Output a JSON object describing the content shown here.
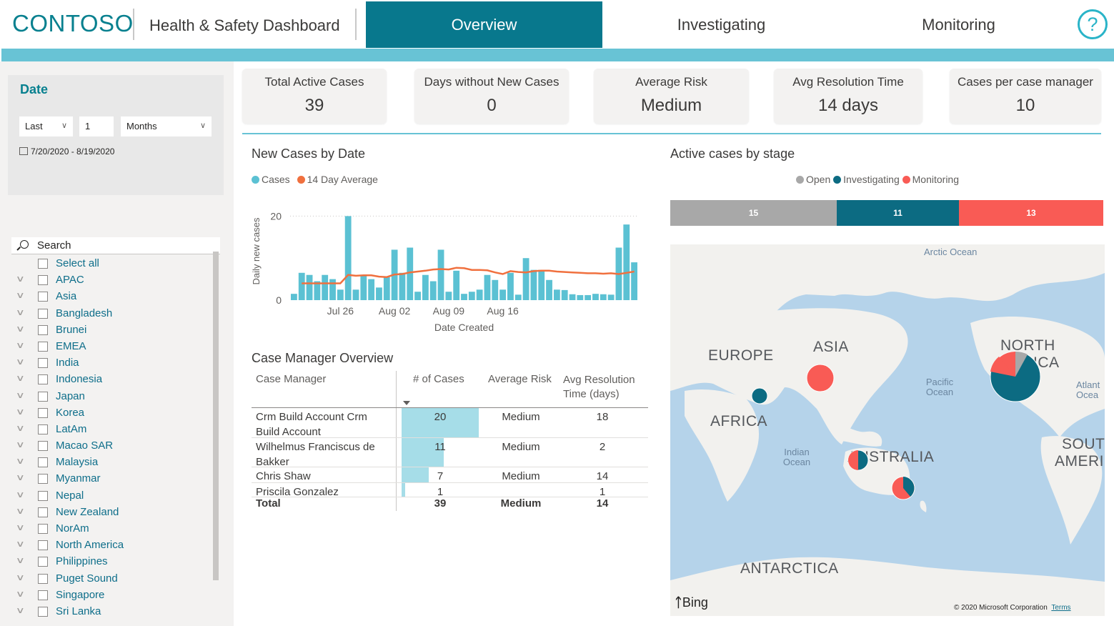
{
  "header": {
    "brand": "CONTOSO",
    "title": "Health & Safety Dashboard",
    "tabs": [
      {
        "label": "Overview",
        "active": true
      },
      {
        "label": "Investigating",
        "active": false
      },
      {
        "label": "Monitoring",
        "active": false
      }
    ],
    "help_icon": "question-circle-icon"
  },
  "date_filter": {
    "title": "Date",
    "relative": "Last",
    "count": "1",
    "unit": "Months",
    "range": "7/20/2020 - 8/19/2020"
  },
  "slicer": {
    "search_placeholder": "Search",
    "items": [
      "Select all",
      "APAC",
      "Asia",
      "Bangladesh",
      "Brunei",
      "EMEA",
      "India",
      "Indonesia",
      "Japan",
      "Korea",
      "LatAm",
      "Macao SAR",
      "Malaysia",
      "Myanmar",
      "Nepal",
      "New Zealand",
      "NorAm",
      "North America",
      "Philippines",
      "Puget Sound",
      "Singapore",
      "Sri Lanka"
    ]
  },
  "kpis": [
    {
      "label": "Total Active Cases",
      "value": "39"
    },
    {
      "label": "Days without New Cases",
      "value": "0"
    },
    {
      "label": "Average Risk",
      "value": "Medium"
    },
    {
      "label": "Avg Resolution Time",
      "value": "14 days"
    },
    {
      "label": "Cases per case manager",
      "value": "10"
    }
  ],
  "new_cases_chart": {
    "title": "New Cases by Date",
    "legend": [
      {
        "name": "Cases",
        "color": "#5bc1d3"
      },
      {
        "name": "14 Day Average",
        "color": "#f0703e"
      }
    ],
    "ylabel": "Daily new cases",
    "xlabel": "Date Created",
    "yticks": [
      "0",
      "20"
    ],
    "xticks": [
      "Jul 26",
      "Aug 02",
      "Aug 09",
      "Aug 16"
    ]
  },
  "chart_data": {
    "type": "bar",
    "title": "New Cases by Date",
    "xlabel": "Date Created",
    "ylabel": "Daily new cases",
    "ylim": [
      0,
      25
    ],
    "categories": [
      "Jul 20",
      "Jul 21",
      "Jul 22",
      "Jul 23",
      "Jul 24",
      "Jul 25",
      "Jul 26",
      "Jul 27",
      "Jul 28",
      "Jul 29",
      "Jul 30",
      "Jul 31",
      "Aug 01",
      "Aug 02",
      "Aug 03",
      "Aug 04",
      "Aug 05",
      "Aug 06",
      "Aug 07",
      "Aug 08",
      "Aug 09",
      "Aug 10",
      "Aug 11",
      "Aug 12",
      "Aug 13",
      "Aug 14",
      "Aug 15",
      "Aug 16",
      "Aug 17",
      "Aug 18",
      "Aug 19",
      "Aug 20",
      "Aug 21",
      "Aug 22",
      "Aug 23",
      "Aug 24",
      "Aug 25",
      "Aug 26",
      "Aug 27",
      "Aug 28",
      "Aug 29",
      "Aug 30",
      "Aug 31",
      "Sep 01",
      "Sep 02"
    ],
    "series": [
      {
        "name": "Cases",
        "type": "bar",
        "color": "#5bc1d3",
        "values": [
          1.5,
          6.5,
          6,
          4.5,
          6,
          5,
          2.5,
          20,
          2.5,
          6,
          5,
          3,
          5.5,
          12,
          6.5,
          12.5,
          2,
          6,
          4.5,
          12,
          2,
          7,
          1.5,
          2,
          2.5,
          6,
          4.8,
          2.5,
          6.5,
          1.3,
          10,
          7.2,
          7.2,
          4.8,
          2.5,
          2.4,
          1.4,
          1.2,
          1.2,
          1.5,
          1.4,
          1.3,
          12.5,
          18,
          9
        ]
      },
      {
        "name": "14 Day Average",
        "type": "line",
        "color": "#f0703e",
        "values": [
          null,
          4,
          4,
          4,
          4,
          4,
          4,
          6,
          5.8,
          5.9,
          5.9,
          5.6,
          5.5,
          6.1,
          6.2,
          6.6,
          6.8,
          7.0,
          7.3,
          7.4,
          7.3,
          7.7,
          7.6,
          7.2,
          7.2,
          7.1,
          6.6,
          6.2,
          6.9,
          6.7,
          6.6,
          6.9,
          7.0,
          7.0,
          6.8,
          6.7,
          6.6,
          6.5,
          6.4,
          6.4,
          6.3,
          6.4,
          6.2,
          6.5,
          6.8
        ]
      }
    ]
  },
  "case_manager_table": {
    "title": "Case Manager Overview",
    "columns": [
      "Case Manager",
      "# of Cases",
      "Average Risk",
      "Avg Resolution Time (days)"
    ],
    "rows": [
      {
        "manager": "Crm Build Account Crm Build Account",
        "cases": 20,
        "risk": "Medium",
        "resolution": "18"
      },
      {
        "manager": "Wilhelmus Franciscus de Bakker",
        "cases": 11,
        "risk": "Medium",
        "resolution": "2"
      },
      {
        "manager": "Chris Shaw",
        "cases": 7,
        "risk": "Medium",
        "resolution": "14"
      },
      {
        "manager": "Priscila Gonzalez",
        "cases": 1,
        "risk": "",
        "resolution": "1"
      }
    ],
    "total": {
      "label": "Total",
      "cases": "39",
      "risk": "Medium",
      "resolution": "14"
    }
  },
  "stage_chart": {
    "title": "Active cases by stage",
    "legend": [
      {
        "name": "Open",
        "color": "#a8a8a8"
      },
      {
        "name": "Investigating",
        "color": "#0c6b82"
      },
      {
        "name": "Monitoring",
        "color": "#f95b55"
      }
    ],
    "segments": [
      {
        "name": "Open",
        "value": 15,
        "label": "15",
        "color": "#a8a8a8"
      },
      {
        "name": "Investigating",
        "value": 11,
        "label": "11",
        "color": "#0c6b82"
      },
      {
        "name": "Monitoring",
        "value": 13,
        "label": "13",
        "color": "#f95b55"
      }
    ]
  },
  "map": {
    "regions": [
      "EUROPE",
      "ASIA",
      "AFRICA",
      "NORTH",
      "ICA",
      "AUSTRALIA",
      "SOUT",
      "AMERIC",
      "ANTARCTICA"
    ],
    "oceans": [
      "Arctic Ocean",
      "Pacific Ocean",
      "Indian Ocean",
      "Atlant Ocea"
    ],
    "attribution": "© 2020 Microsoft Corporation",
    "terms": "Terms",
    "provider": "Bing"
  }
}
